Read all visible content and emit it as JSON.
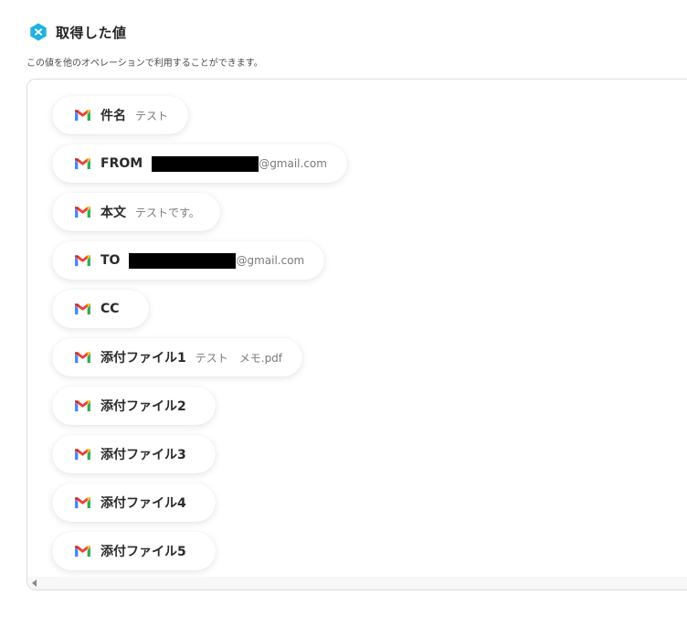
{
  "header": {
    "title": "取得した値",
    "description": "この値を他のオペレーションで利用することができます。",
    "icon": "x-hexagon-icon",
    "accent_color": "#21b2de"
  },
  "values": [
    {
      "label": "件名",
      "value": "テスト"
    },
    {
      "label": "FROM",
      "value": "@gmail.com",
      "redacted": true
    },
    {
      "label": "本文",
      "value": "テストです。"
    },
    {
      "label": "TO",
      "value": "@gmail.com",
      "redacted": true
    },
    {
      "label": "CC",
      "value": ""
    },
    {
      "label": "添付ファイル1",
      "value": "テスト　メモ.pdf"
    },
    {
      "label": "添付ファイル2",
      "value": ""
    },
    {
      "label": "添付ファイル3",
      "value": ""
    },
    {
      "label": "添付ファイル4",
      "value": ""
    },
    {
      "label": "添付ファイル5",
      "value": ""
    }
  ],
  "icons": {
    "chip": "gmail-icon",
    "scroll": "scroll-left-arrow-icon"
  }
}
